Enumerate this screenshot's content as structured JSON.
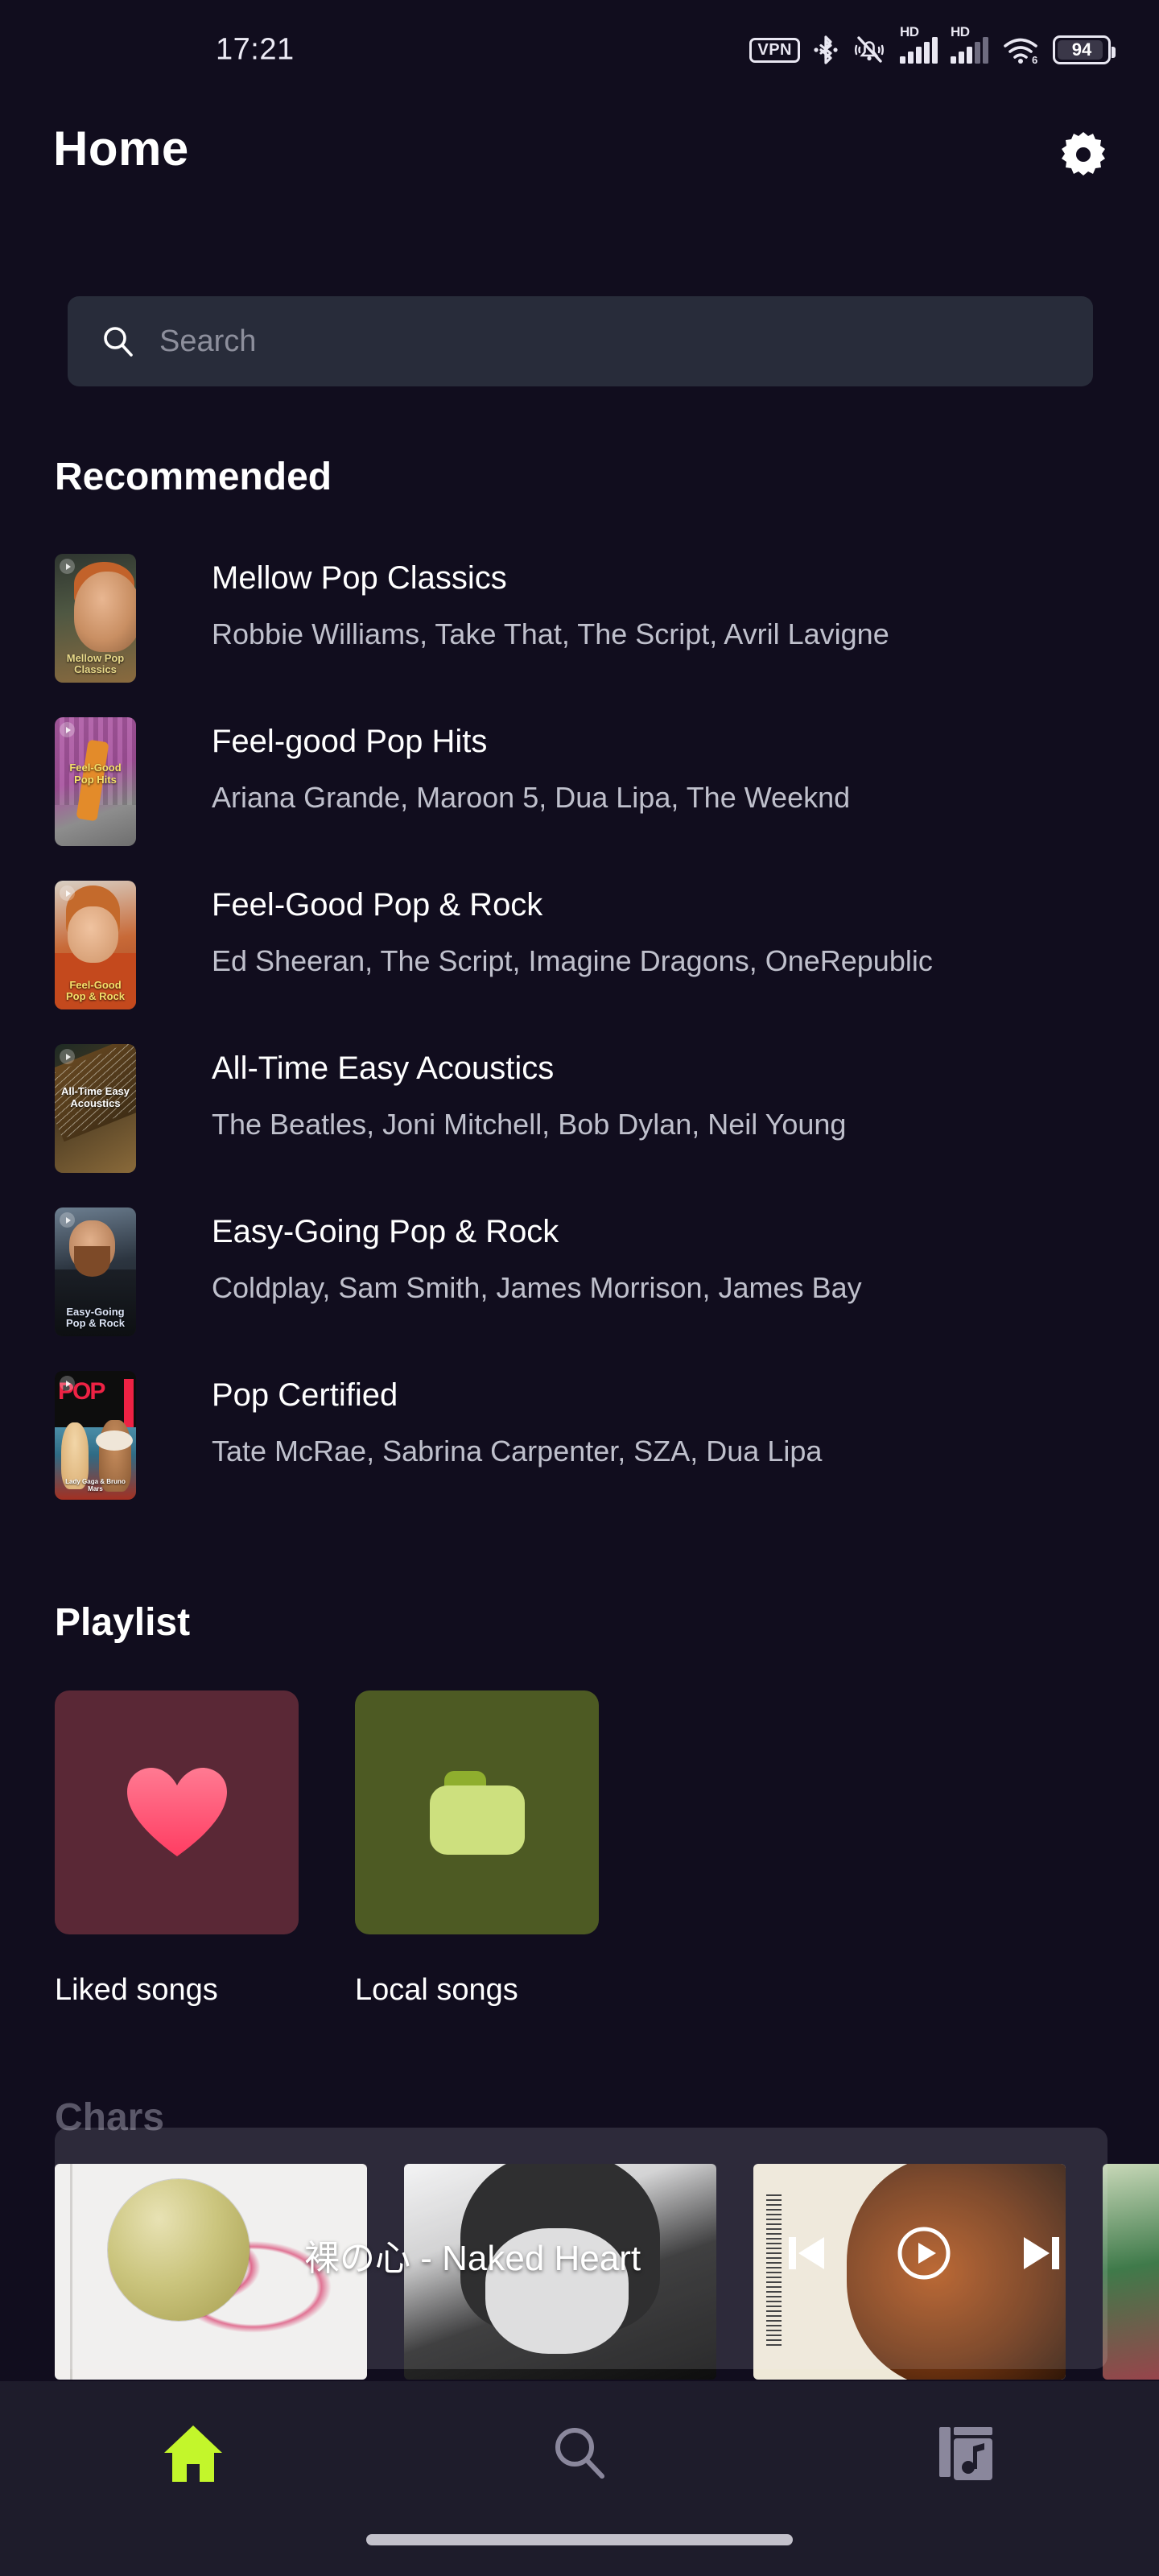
{
  "status_bar": {
    "time": "17:21",
    "vpn_label": "VPN",
    "hd_label_1": "HD",
    "hd_label_2": "HD",
    "wifi_generation": "6",
    "battery_percent": "94",
    "icons": [
      "vpn-badge",
      "bluetooth-icon",
      "bell-muted-icon",
      "cellular-signal-icon",
      "cellular-signal-icon",
      "wifi-icon",
      "battery-icon"
    ]
  },
  "header": {
    "title": "Home",
    "settings_icon": "gear-icon"
  },
  "search": {
    "placeholder": "Search",
    "value": "",
    "icon": "search-icon"
  },
  "sections": {
    "recommended_title": "Recommended",
    "playlist_title": "Playlist",
    "charts_title": "Chars"
  },
  "recommended": [
    {
      "name": "Mellow Pop Classics",
      "artists": "Robbie Williams, Take That, The Script, Avril Lavigne",
      "cover_caption_line1": "Mellow Pop",
      "cover_caption_line2": "Classics",
      "caption_color": "#e8d98a"
    },
    {
      "name": "Feel-good Pop Hits",
      "artists": "Ariana Grande, Maroon 5, Dua Lipa, The Weeknd",
      "cover_caption_line1": "Feel-Good",
      "cover_caption_line2": "Pop Hits",
      "caption_color": "#f5e06a"
    },
    {
      "name": "Feel-Good Pop & Rock",
      "artists": "Ed Sheeran, The Script, Imagine Dragons, OneRepublic",
      "cover_caption_line1": "Feel-Good",
      "cover_caption_line2": "Pop & Rock",
      "caption_color": "#f5e06a"
    },
    {
      "name": "All-Time Easy Acoustics",
      "artists": "The Beatles, Joni Mitchell, Bob Dylan, Neil Young",
      "cover_caption_line1": "All-Time Easy",
      "cover_caption_line2": "Acoustics",
      "caption_color": "#ffffff"
    },
    {
      "name": "Easy-Going Pop & Rock",
      "artists": "Coldplay, Sam Smith, James Morrison, James Bay",
      "cover_caption_line1": "Easy-Going",
      "cover_caption_line2": "Pop & Rock",
      "caption_color": "#dbe3f5"
    },
    {
      "name": "Pop Certified",
      "artists": "Tate McRae, Sabrina Carpenter, SZA, Dua Lipa",
      "cover_caption_line1": "POP",
      "cover_caption_line2": "Lady Gaga & Bruno Mars",
      "caption_color": "#ffffff"
    }
  ],
  "playlists": [
    {
      "label": "Liked songs",
      "icon": "heart-icon",
      "card_color": "#5a2836",
      "icon_color": "#ff4d6d"
    },
    {
      "label": "Local songs",
      "icon": "folder-icon",
      "card_color": "#4d5a23",
      "icon_color": "#ccdd77"
    }
  ],
  "mini_player": {
    "now_playing": "裸の心 - Naked Heart",
    "prev_icon": "skip-previous-icon",
    "play_icon": "play-circle-icon",
    "next_icon": "skip-next-icon",
    "is_playing": false
  },
  "bottom_nav": [
    {
      "name": "home",
      "icon": "home-icon",
      "active": true,
      "color": "#c3f62b"
    },
    {
      "name": "search",
      "icon": "search-icon",
      "active": false,
      "color": "#8a879c"
    },
    {
      "name": "library",
      "icon": "library-music-icon",
      "active": false,
      "color": "#8a879c"
    }
  ],
  "theme": {
    "background": "#110d1e",
    "search_field": "#282c3a",
    "nav_background": "#1e1c2b",
    "accent": "#c3f62b",
    "primary_text": "#ffffff",
    "secondary_text": "#bfc0cc"
  }
}
